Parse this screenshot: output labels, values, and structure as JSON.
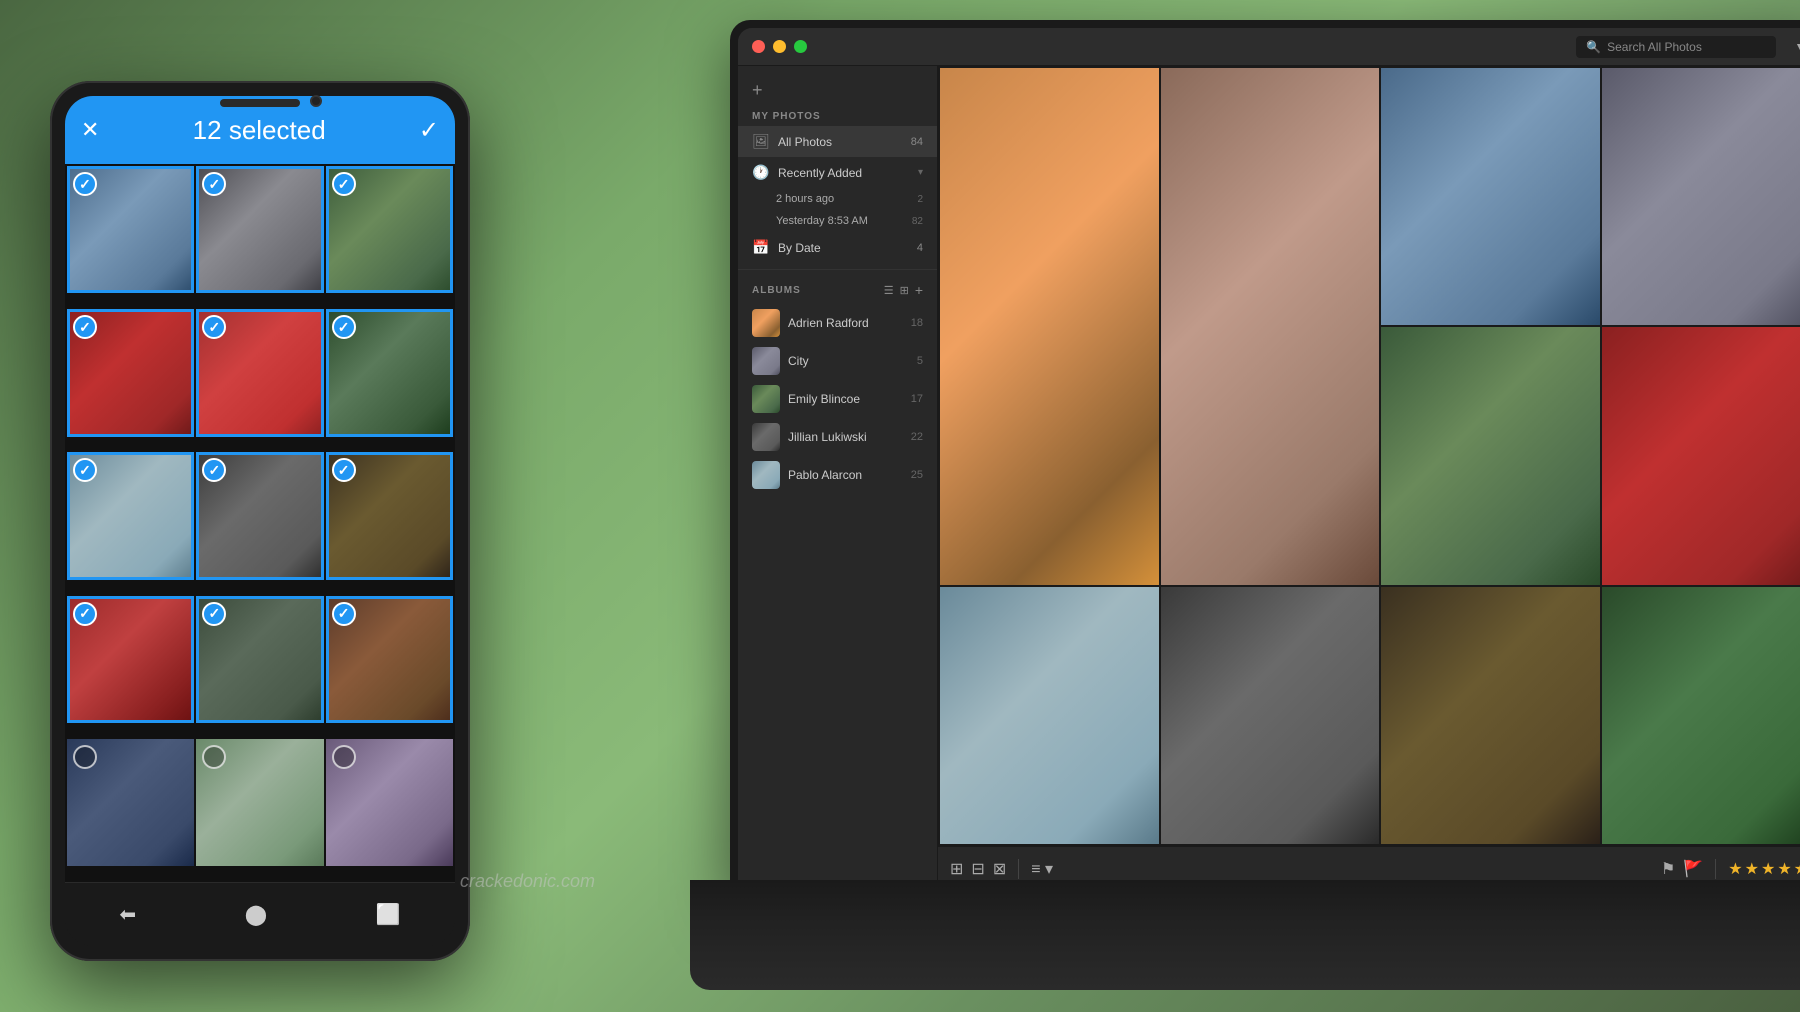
{
  "background": {
    "color1": "#4a6741",
    "color2": "#8aba78"
  },
  "phone": {
    "header": {
      "selected_count": "12 selected",
      "close_icon": "✕",
      "check_icon": "✓"
    },
    "grid": {
      "cells": [
        {
          "id": 1,
          "selected": true,
          "color": "c-jump"
        },
        {
          "id": 2,
          "selected": true,
          "color": "c-gray-portrait"
        },
        {
          "id": 3,
          "selected": true,
          "color": "c-green-food"
        },
        {
          "id": 4,
          "selected": true,
          "color": "c-red-wall"
        },
        {
          "id": 5,
          "selected": true,
          "color": "c-red-wall"
        },
        {
          "id": 6,
          "selected": true,
          "color": "c-green-food"
        },
        {
          "id": 7,
          "selected": true,
          "color": "c-cloud"
        },
        {
          "id": 8,
          "selected": true,
          "color": "c-portrait-bw"
        },
        {
          "id": 9,
          "selected": true,
          "color": "c-gold-circle"
        },
        {
          "id": 10,
          "selected": true,
          "color": "c-door-red"
        },
        {
          "id": 11,
          "selected": true,
          "color": "c-forest-road"
        },
        {
          "id": 12,
          "selected": true,
          "color": "c-autumn"
        },
        {
          "id": 13,
          "selected": false,
          "color": "c-graffiti"
        },
        {
          "id": 14,
          "selected": false,
          "color": "c-window"
        },
        {
          "id": 15,
          "selected": false,
          "color": "c-flowers"
        }
      ]
    },
    "nav": {
      "back": "⬅",
      "home": "⬤",
      "recent": "⬜"
    }
  },
  "laptop": {
    "titlebar": {
      "search_placeholder": "Search All Photos",
      "filter_icon": "▼"
    },
    "sidebar": {
      "add_icon": "+",
      "my_photos_label": "MY PHOTOS",
      "items": [
        {
          "icon": "🖼",
          "label": "All Photos",
          "count": "84",
          "active": true
        },
        {
          "icon": "🕐",
          "label": "Recently Added",
          "count": "",
          "active": false
        }
      ],
      "sub_items": [
        {
          "label": "2 hours ago",
          "count": "2"
        },
        {
          "label": "Yesterday 8:53 AM",
          "count": "82"
        }
      ],
      "by_date": {
        "label": "By Date",
        "count": "4"
      },
      "albums_label": "ALBUMS",
      "albums": [
        {
          "name": "Adrien Radford",
          "count": "18",
          "color": "c-orange"
        },
        {
          "name": "City",
          "count": "5",
          "color": "c-city"
        },
        {
          "name": "Emily Blincoe",
          "count": "17",
          "color": "c-green-food"
        },
        {
          "name": "Jillian Lukiwski",
          "count": "22",
          "color": "c-portrait-bw"
        },
        {
          "name": "Pablo Alarcon",
          "count": "25",
          "color": "c-cloud"
        }
      ]
    },
    "photo_grid": {
      "cells": [
        {
          "row": 1,
          "col": 1,
          "color": "c-orange",
          "span_row": 2
        },
        {
          "row": 1,
          "col": 2,
          "color": "c-portrait-f",
          "span_row": 2
        },
        {
          "row": 1,
          "col": 3,
          "color": "c-jump"
        },
        {
          "row": 1,
          "col": 4,
          "color": "c-city"
        },
        {
          "row": 2,
          "col": 3,
          "color": "c-cloud"
        },
        {
          "row": 2,
          "col": 4,
          "color": "c-red-wall"
        },
        {
          "row": 3,
          "col": 1,
          "color": "c-green-food"
        },
        {
          "row": 3,
          "col": 2,
          "color": "c-red-wall"
        },
        {
          "row": 3,
          "col": 3,
          "color": "c-portrait-bw"
        },
        {
          "row": 3,
          "col": 4,
          "color": "c-gold-circle"
        }
      ]
    },
    "toolbar": {
      "view_icons": [
        "⊞",
        "⊟",
        "⊠",
        "≡"
      ],
      "stars": "★★★★★",
      "flag_icon": "⚑"
    }
  },
  "watermark": "crackedonic.com"
}
